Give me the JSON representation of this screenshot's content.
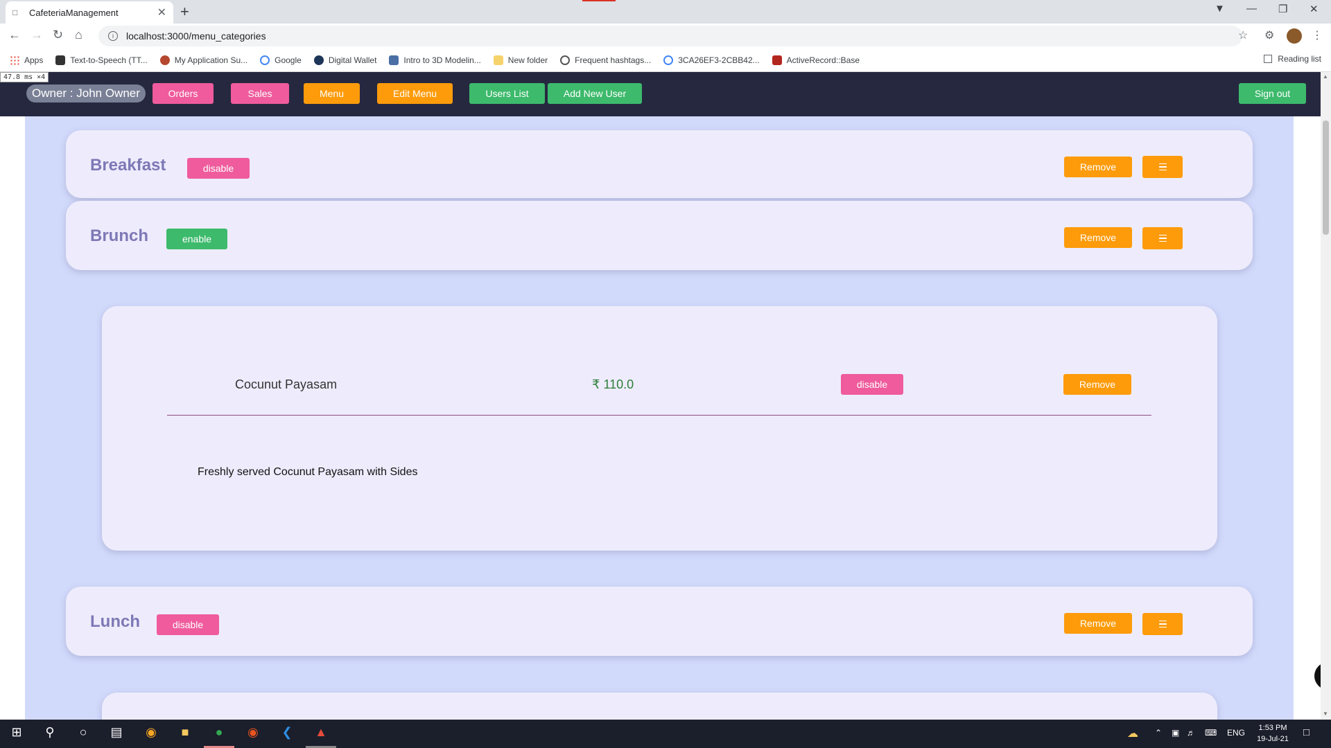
{
  "browser": {
    "tab_title": "CafeteriaManagement",
    "url": "localhost:3000/menu_categories",
    "bookmarks": [
      {
        "label": "Apps",
        "color": "#ea4335"
      },
      {
        "label": "Text-to-Speech (TT...",
        "color": "#333333"
      },
      {
        "label": "My Application Su...",
        "color": "#b5472e"
      },
      {
        "label": "Google",
        "color": "#4285f4"
      },
      {
        "label": "Digital Wallet",
        "color": "#1d3557"
      },
      {
        "label": "Intro to 3D Modelin...",
        "color": "#4a6fa5"
      },
      {
        "label": "New folder",
        "color": "#f6d26b"
      },
      {
        "label": "Frequent hashtags...",
        "color": "#555555"
      },
      {
        "label": "3CA26EF3-2CBB42...",
        "color": "#4285f4"
      },
      {
        "label": "ActiveRecord::Base",
        "color": "#b3261e"
      }
    ],
    "reading_list": "Reading list"
  },
  "perf_overlay": "47.8 ms ×4",
  "navbar": {
    "owner": "Owner : John Owner",
    "orders": "Orders",
    "sales": "Sales",
    "menu": "Menu",
    "edit_menu": "Edit Menu",
    "users_list": "Users List",
    "add_new_user": "Add New User",
    "sign_out": "Sign out"
  },
  "categories": [
    {
      "name": "Breakfast",
      "toggle": "disable",
      "remove": "Remove"
    },
    {
      "name": "Brunch",
      "toggle": "enable",
      "remove": "Remove"
    },
    {
      "name": "Lunch",
      "toggle": "disable",
      "remove": "Remove"
    }
  ],
  "item": {
    "name": "Cocunut Payasam",
    "price": "₹ 110.0",
    "toggle": "disable",
    "remove": "Remove",
    "description": "Freshly served Cocunut Payasam with Sides"
  },
  "taskbar": {
    "lang": "ENG",
    "time": "1:53 PM",
    "date": "19-Jul-21"
  },
  "colors": {
    "navbar": "#262840",
    "pink": "#ef5b9c",
    "orange": "#fd9b0b",
    "green": "#3dba6c",
    "card": "#eeecfc",
    "content_bg": "#d2dafc"
  }
}
